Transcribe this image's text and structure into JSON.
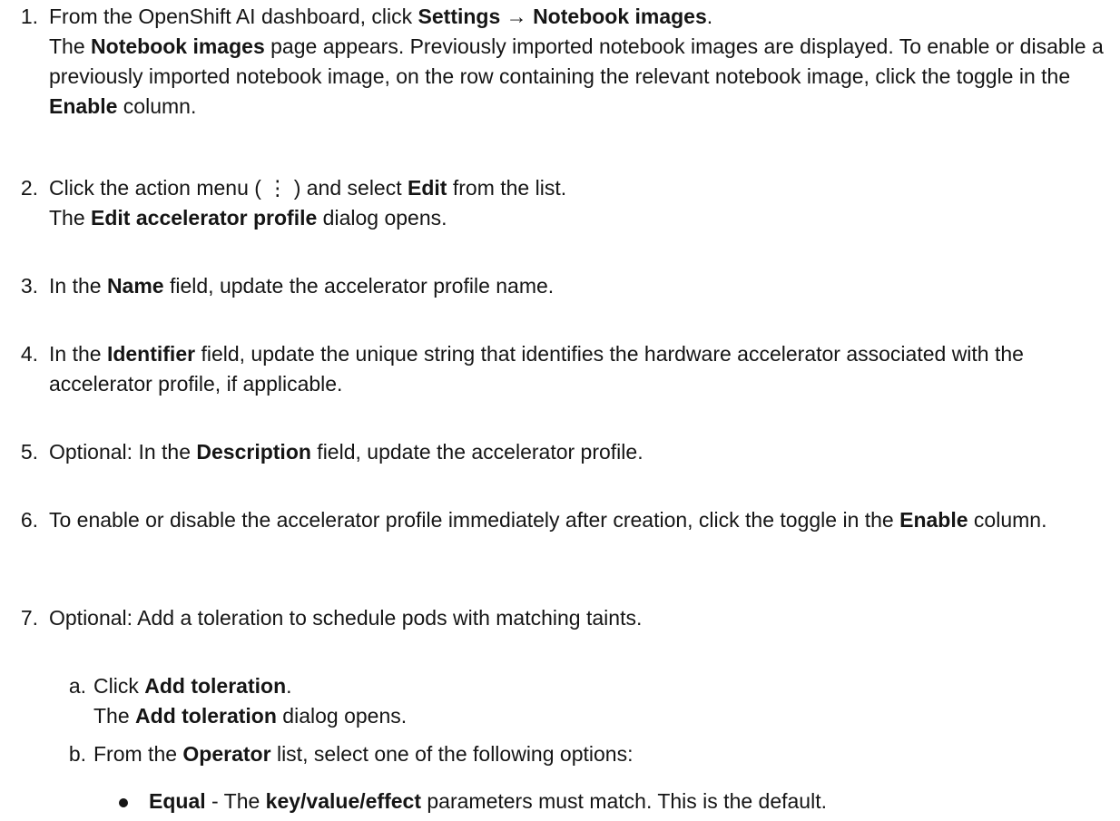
{
  "steps": [
    {
      "num": "1.",
      "p1_a": "From the OpenShift AI dashboard, click ",
      "p1_b1": "Settings",
      "p1_arrow": " → ",
      "p1_b2": "Notebook images",
      "p1_c": ".",
      "p2_a": "The ",
      "p2_b": "Notebook images",
      "p2_c": " page appears. Previously imported notebook images are displayed. To enable or disable a previously imported notebook image, on the row containing the relevant notebook image, click the toggle in the ",
      "p2_d": "Enable",
      "p2_e": " column."
    },
    {
      "num": "2.",
      "p1_a": "Click the action menu ( ",
      "p1_icon": "⋮",
      "p1_b": " ) and select ",
      "p1_c": "Edit",
      "p1_d": " from the list.",
      "p2_a": "The ",
      "p2_b": "Edit accelerator profile",
      "p2_c": " dialog opens."
    },
    {
      "num": "3.",
      "a": "In the ",
      "b": "Name",
      "c": " field, update the accelerator profile name."
    },
    {
      "num": "4.",
      "a": "In the ",
      "b": "Identifier",
      "c": " field, update the unique string that identifies the hardware accelerator associated with the accelerator profile, if applicable."
    },
    {
      "num": "5.",
      "a": "Optional: In the ",
      "b": "Description",
      "c": " field, update the accelerator profile."
    },
    {
      "num": "6.",
      "a": "To enable or disable the accelerator profile immediately after creation, click the toggle in the ",
      "b": "Enable",
      "c": " column."
    },
    {
      "num": "7.",
      "a": "Optional: Add a toleration to schedule pods with matching taints."
    }
  ],
  "substeps": [
    {
      "num": "a.",
      "p1_a": "Click ",
      "p1_b": "Add toleration",
      "p1_c": ".",
      "p2_a": "The ",
      "p2_b": "Add toleration",
      "p2_c": " dialog opens."
    },
    {
      "num": "b.",
      "a": "From the ",
      "b": "Operator",
      "c": " list, select one of the following options:"
    }
  ],
  "bullets": [
    {
      "b1": "Equal",
      "a": " - The ",
      "b2": "key/value/effect",
      "c": " parameters must match. This is the default."
    }
  ]
}
